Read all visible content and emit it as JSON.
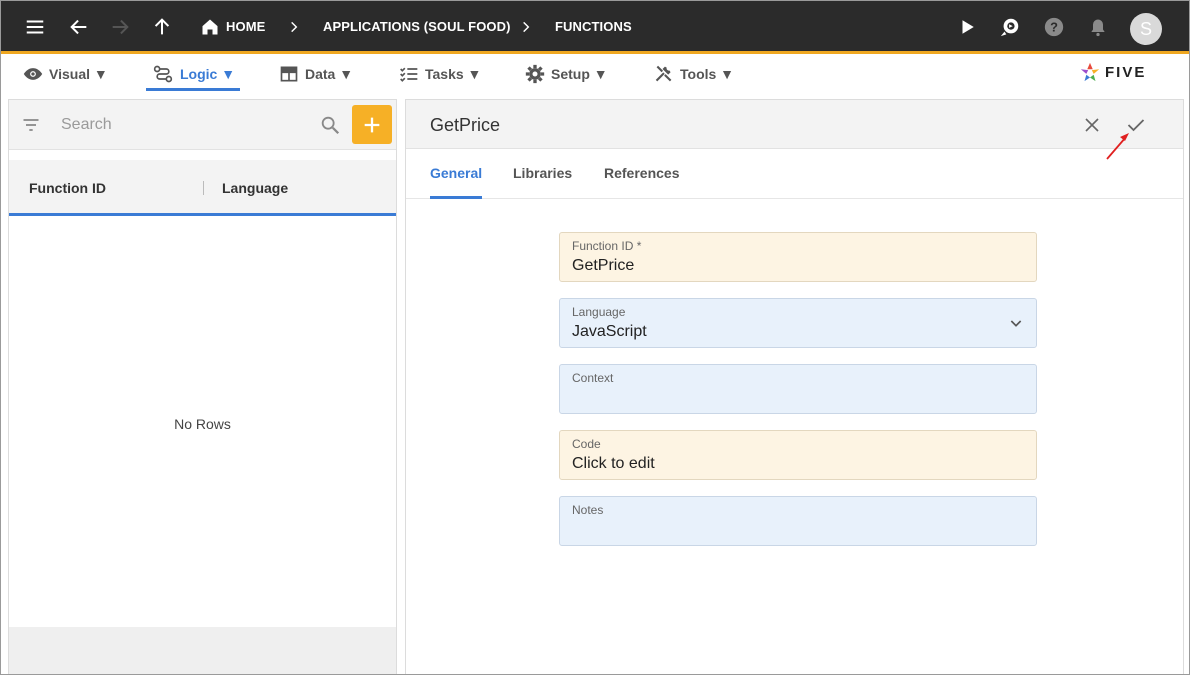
{
  "topbar": {
    "breadcrumbs": [
      "HOME",
      "APPLICATIONS (SOUL FOOD)",
      "FUNCTIONS"
    ],
    "avatar_initial": "S"
  },
  "menu": {
    "items": [
      {
        "label": "Visual ▼"
      },
      {
        "label": "Logic ▼"
      },
      {
        "label": "Data ▼"
      },
      {
        "label": "Tasks ▼"
      },
      {
        "label": "Setup ▼"
      },
      {
        "label": "Tools ▼"
      }
    ],
    "active": "Logic"
  },
  "logo": {
    "text": "FIVE"
  },
  "list": {
    "search_placeholder": "Search",
    "columns": [
      "Function ID",
      "Language"
    ],
    "empty_text": "No Rows"
  },
  "form": {
    "title": "GetPrice",
    "tabs": [
      "General",
      "Libraries",
      "References"
    ],
    "fields": [
      {
        "label": "Function ID *",
        "value": "GetPrice"
      },
      {
        "label": "Language",
        "value": "JavaScript"
      },
      {
        "label": "Context",
        "value": ""
      },
      {
        "label": "Code",
        "value": "Click to edit"
      },
      {
        "label": "Notes",
        "value": ""
      }
    ]
  },
  "colors": {
    "topbar_bg": "#2b2b2b",
    "accent_orange": "#f0a821",
    "accent_blue": "#3a7bd5",
    "add_button": "#f6b026",
    "annotation_arrow": "#e02020"
  }
}
